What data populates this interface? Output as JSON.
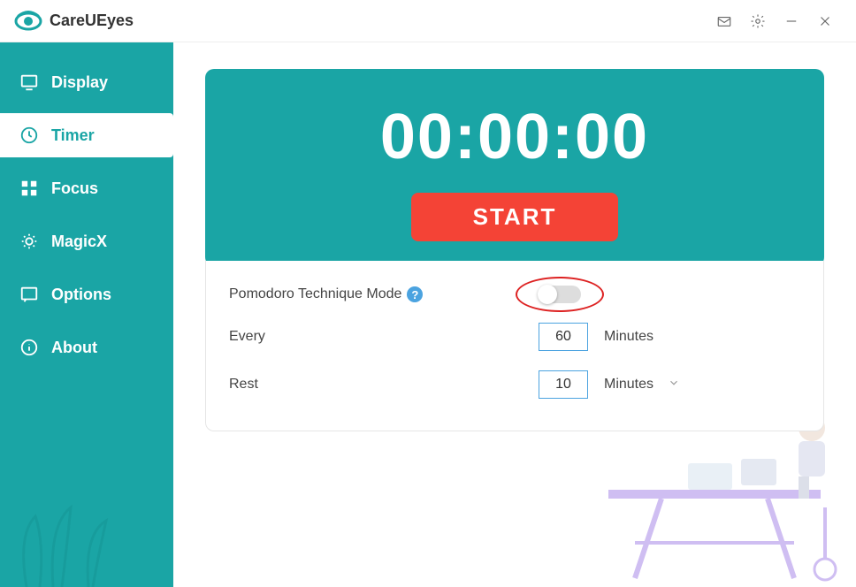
{
  "app": {
    "name": "CareUEyes"
  },
  "sidebar": {
    "items": [
      {
        "label": "Display"
      },
      {
        "label": "Timer"
      },
      {
        "label": "Focus"
      },
      {
        "label": "MagicX"
      },
      {
        "label": "Options"
      },
      {
        "label": "About"
      }
    ]
  },
  "timer": {
    "display": "00:00:00",
    "start_label": "START"
  },
  "settings": {
    "pomodoro_label": "Pomodoro Technique Mode",
    "every_label": "Every",
    "every_value": "60",
    "every_unit": "Minutes",
    "rest_label": "Rest",
    "rest_value": "10",
    "rest_unit": "Minutes"
  }
}
